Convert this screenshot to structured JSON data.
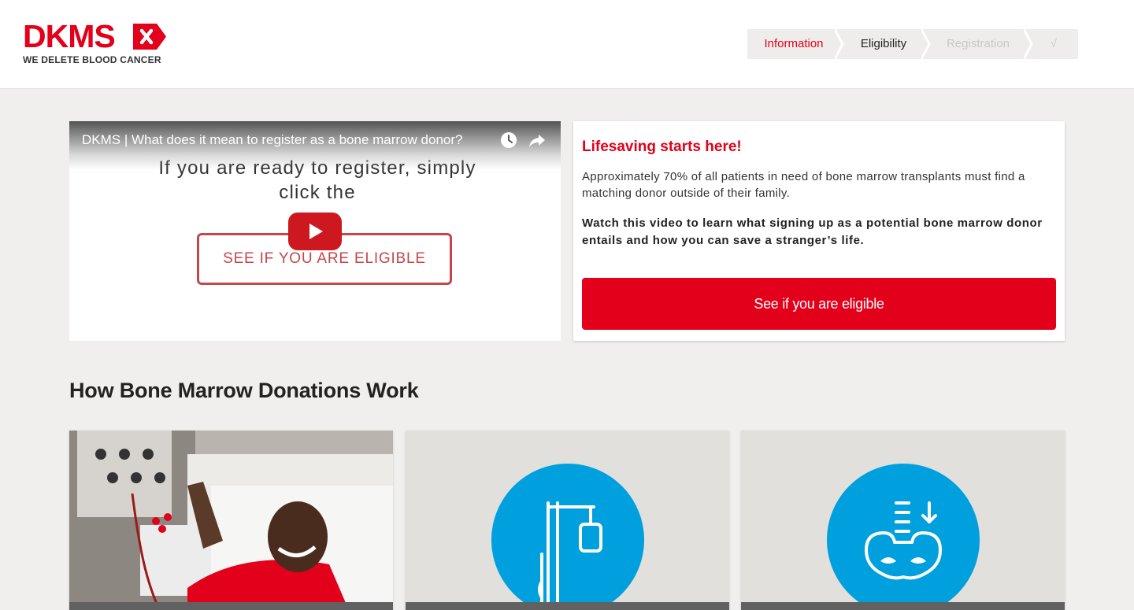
{
  "brand": {
    "name": "DKMS",
    "tagline": "WE DELETE BLOOD CANCER",
    "color": "#e2001a"
  },
  "steps": [
    {
      "label": "Information",
      "state": "current"
    },
    {
      "label": "Eligibility",
      "state": "next"
    },
    {
      "label": "Registration",
      "state": "disabled"
    },
    {
      "label": "√",
      "state": "disabled"
    }
  ],
  "video": {
    "title": "DKMS | What does it mean to register as a bone marrow donor?",
    "overlay_line1": "If you are ready to register, simply",
    "overlay_line2": "click the",
    "overlay_button": "SEE IF YOU ARE ELIGIBLE",
    "icons": [
      "watch-later-icon",
      "share-icon",
      "youtube-play-icon"
    ]
  },
  "info_card": {
    "title": "Lifesaving starts here!",
    "text": "Approximately 70% of all patients in need of bone marrow transplants must find a matching donor outside of their family.",
    "bold_text": "Watch this video to learn what signing up as a potential bone marrow donor entails and how you can save a stranger’s life.",
    "button": "See if you are eligible"
  },
  "section": {
    "title": "How Bone Marrow Donations Work"
  },
  "tiles": [
    {
      "kind": "photo",
      "icon": "donor-photo"
    },
    {
      "kind": "icon",
      "icon": "iv-drip-icon",
      "circle_color": "#00a0de"
    },
    {
      "kind": "icon",
      "icon": "pelvis-bone-icon",
      "circle_color": "#00a0de"
    }
  ]
}
